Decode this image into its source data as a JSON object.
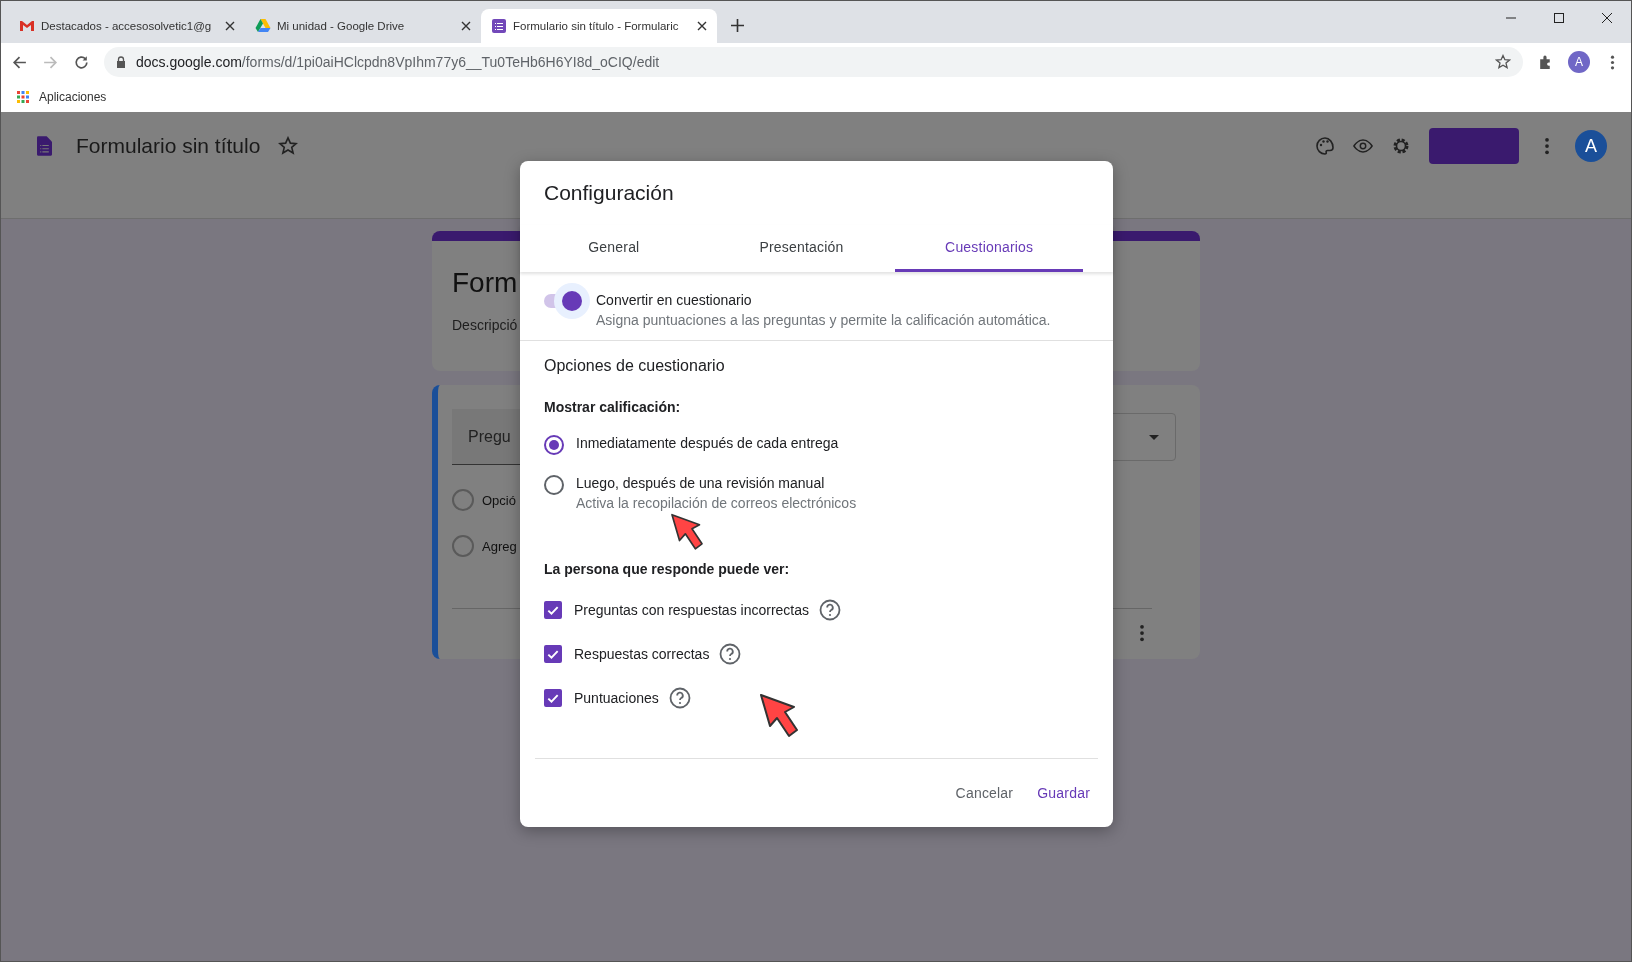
{
  "browser": {
    "tabs": [
      {
        "kind": "gmail",
        "title": "Destacados - accesosolvetic1@g",
        "selected": false
      },
      {
        "kind": "drive",
        "title": "Mi unidad - Google Drive",
        "selected": false
      },
      {
        "kind": "forms",
        "title": "Formulario sin título - Formularic",
        "selected": true
      }
    ],
    "url_host": "docs.google.com",
    "url_path": "/forms/d/1pi0aiHClcpdn8VpIhm77y6__Tu0TeHb6H6YI8d_oCIQ/edit",
    "profile_initial": "A",
    "bookmarks": [
      "Aplicaciones"
    ]
  },
  "forms_header": {
    "title": "Formulario sin título",
    "avatar_initial": "A"
  },
  "form_behind": {
    "title": "Form",
    "description": "Descripció",
    "question": "Pregu",
    "options": [
      {
        "label": "Opció",
        "selected": false
      },
      {
        "label": "Agreg",
        "selected": false
      }
    ]
  },
  "dialog": {
    "title": "Configuración",
    "tabs": [
      {
        "label": "General",
        "selected": false
      },
      {
        "label": "Presentación",
        "selected": false
      },
      {
        "label": "Cuestionarios",
        "selected": true
      }
    ],
    "quiz_toggle": {
      "label": "Convertir en cuestionario",
      "description": "Asigna puntuaciones a las preguntas y permite la calificación automática.",
      "on": true
    },
    "section_title": "Opciones de cuestionario",
    "grade_heading": "Mostrar calificación:",
    "grade_options": [
      {
        "label": "Inmediatamente después de cada entrega",
        "selected": true
      },
      {
        "label": "Luego, después de una revisión manual",
        "hint": "Activa la recopilación de correos electrónicos",
        "selected": false
      }
    ],
    "view_heading": "La persona que responde puede ver:",
    "view_options": [
      {
        "label": "Preguntas con respuestas incorrectas",
        "checked": true
      },
      {
        "label": "Respuestas correctas",
        "checked": true
      },
      {
        "label": "Puntuaciones",
        "checked": true
      }
    ],
    "cancel": "Cancelar",
    "save": "Guardar"
  }
}
